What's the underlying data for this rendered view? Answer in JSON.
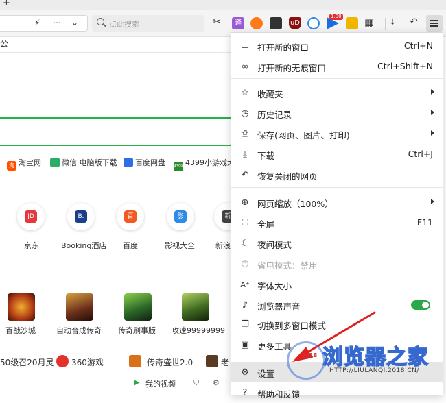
{
  "colors": {
    "toggle_on": "#2aa84a",
    "highlight": "#e6e6e6",
    "green_outline": "#25b04a",
    "arrow": "#e02020",
    "watermark": "#3569cf"
  },
  "tab_strip": {
    "new_tab_glyph": "+"
  },
  "toolbar": {
    "address_icons": [
      "lightning-icon",
      "more-icon",
      "chevron-down-icon"
    ],
    "search_placeholder": "点此搜索",
    "extension_badge": "1.00",
    "ext_translate_label": "译",
    "ext_adblock_label": "uD",
    "menu_icon": "hamburger-icon"
  },
  "page": {
    "gong_partial": "公",
    "quick_links": [
      "淘宝网",
      "微信 电脑版下载",
      "百度网盘",
      "4399小游戏大"
    ],
    "quick_link_badges": [
      "淘",
      "",
      "",
      "4399"
    ],
    "sites": [
      {
        "label": "京东",
        "badge": "JD",
        "color": "#e3393c"
      },
      {
        "label": "Booking酒店",
        "badge": "B.",
        "color": "#1c3f8a"
      },
      {
        "label": "百度",
        "badge": "百",
        "color": "#f35a22"
      },
      {
        "label": "影视大全",
        "badge": "影",
        "color": "#2f8be6"
      },
      {
        "label": "新浪",
        "badge": "新",
        "color": "#444444"
      }
    ],
    "games": [
      {
        "label": "百战沙城",
        "color": "#b23a15"
      },
      {
        "label": "自动合成传奇",
        "color": "#6a2f1a"
      },
      {
        "label": "传奇刷事版",
        "color": "#2d6a2a"
      },
      {
        "label": "攻速99999999",
        "color": "#3f6b22"
      }
    ],
    "bottom_items": [
      "50级召20月灵",
      "360游戏",
      "传奇盛世2.0",
      "老"
    ],
    "footer_text": "我的视频"
  },
  "menu": {
    "items": [
      {
        "label": "打开新的窗口",
        "shortcut": "Ctrl+N",
        "icon": "window-icon",
        "glyph": "▭"
      },
      {
        "label": "打开新的无痕窗口",
        "shortcut": "Ctrl+Shift+N",
        "icon": "incognito-icon",
        "glyph": "∞"
      },
      {
        "label": "收藏夹",
        "icon": "star-icon",
        "glyph": "☆"
      },
      {
        "label": "历史记录",
        "icon": "clock-icon",
        "glyph": "◷"
      },
      {
        "label": "保存(网页、图片、打印)",
        "icon": "save-icon",
        "glyph": "⎙"
      },
      {
        "label": "下载",
        "shortcut": "Ctrl+J",
        "icon": "download-icon",
        "glyph": "⤓"
      },
      {
        "label": "恢复关闭的网页",
        "icon": "undo-icon",
        "glyph": "↶"
      },
      {
        "label": "网页缩放（100%）",
        "icon": "zoom-icon",
        "glyph": "⊕"
      },
      {
        "label": "全屏",
        "shortcut": "F11",
        "icon": "fullscreen-icon",
        "glyph": "⛶"
      },
      {
        "label": "夜间模式",
        "icon": "moon-icon",
        "glyph": "☾"
      },
      {
        "label": "省电模式：禁用",
        "icon": "plug-icon",
        "glyph": "⏻"
      },
      {
        "label": "字体大小",
        "icon": "font-size-icon",
        "glyph": "A⁺"
      },
      {
        "label": "浏览器声音",
        "icon": "speaker-icon",
        "glyph": "♪"
      },
      {
        "label": "切换到多窗口模式",
        "icon": "multi-window-icon",
        "glyph": "❐"
      },
      {
        "label": "更多工具",
        "icon": "toolbox-icon",
        "glyph": "▣"
      },
      {
        "label": "设置",
        "icon": "gear-icon",
        "glyph": "⚙"
      },
      {
        "label": "帮助和反馈",
        "icon": "help-icon",
        "glyph": "?"
      }
    ]
  },
  "watermark": {
    "title": "浏览器之家",
    "url": "HTTP://LIULANQI.2018.CN/",
    "year": "2018"
  }
}
